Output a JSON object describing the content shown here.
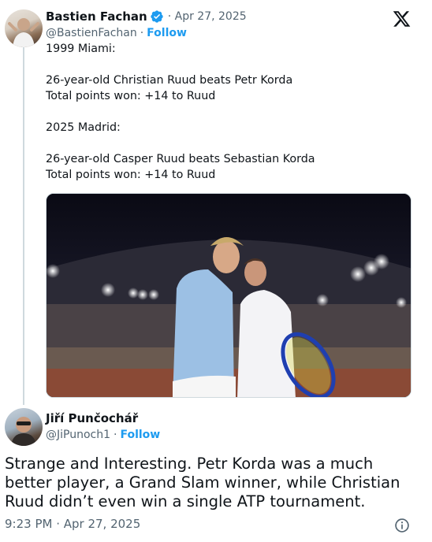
{
  "tweet": {
    "author_name": "Bastien Fachan",
    "separator_date": "· Apr 27, 2025",
    "handle": "@BastienFachan",
    "dot": "·",
    "follow_label": "Follow",
    "lines": [
      "1999 Miami:",
      "26-year-old Christian Ruud beats Petr Korda",
      "Total points won: +14 to Ruud",
      "2025 Madrid:",
      "26-year-old Casper Ruud beats Sebastian Korda",
      "Total points won: +14 to Ruud"
    ],
    "media_icon": "photo-two-tennis-players-embracing"
  },
  "reply": {
    "author_name": "Jiří Punčochář",
    "handle": "@JiPunoch1",
    "dot": "·",
    "follow_label": "Follow",
    "text": "Strange and Interesting. Petr Korda was a much better player, a Grand Slam winner, while Christian Ruud didn’t even win a single ATP tournament.",
    "timestamp": "9:23 PM · Apr 27, 2025"
  },
  "icons": {
    "verified": "verified-badge-icon",
    "brand": "x-logo-icon",
    "info": "info-icon"
  },
  "colors": {
    "accent": "#1d9bf0",
    "text": "#0f1419",
    "muted": "#536471",
    "thread_line": "#cfd9de"
  }
}
